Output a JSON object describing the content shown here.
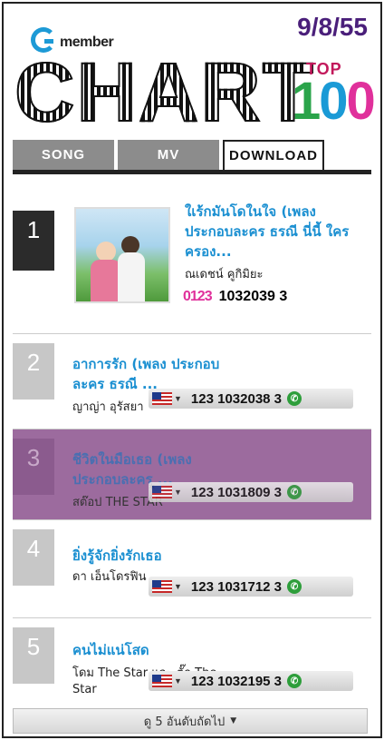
{
  "header": {
    "brand": "member",
    "date": "9/8/55",
    "chart_word": "CHART",
    "top_label": "TOP",
    "top_number": [
      "1",
      "0",
      "0"
    ]
  },
  "tabs": [
    {
      "label": "SONG",
      "active": false
    },
    {
      "label": "MV",
      "active": false
    },
    {
      "label": "DOWNLOAD",
      "active": true
    }
  ],
  "items": [
    {
      "rank": "1",
      "title": "ใเร้กมันโดในใจ (เพลง ประกอบละคร ธรณี นี่นี้ ใครครอง...",
      "artist": "ณเดชน์ คูกิมิยะ",
      "code": "1032039 3",
      "code_prefix": "0123"
    },
    {
      "rank": "2",
      "title": "อาการรัก (เพลง ประกอบละคร ธรณี ...",
      "artist": "ญาญ่า อุรัสยา",
      "code": "123 1032038 3"
    },
    {
      "rank": "3",
      "title": "ชีวิตในมือเธอ (เพลง ประกอบละคร ...",
      "artist": "สต๊อป THE STAR",
      "code": "123 1031809 3"
    },
    {
      "rank": "4",
      "title": "ยิ่งรู้จักยิ่งรักเธอ",
      "artist": "ดา เอ็นโดรฟิน",
      "code": "123 1031712 3"
    },
    {
      "rank": "5",
      "title": "คนไม่แน่โสด",
      "artist": "โดม The Star และ ตั๊ก The Star",
      "code": "123 1032195 3"
    }
  ],
  "footer": {
    "more_label": "ดู 5 อันดับถัดไป"
  },
  "colors": {
    "accent": "#1a8fd1",
    "highlight_row": "#9c6b9e",
    "date": "#4a1f7a"
  }
}
